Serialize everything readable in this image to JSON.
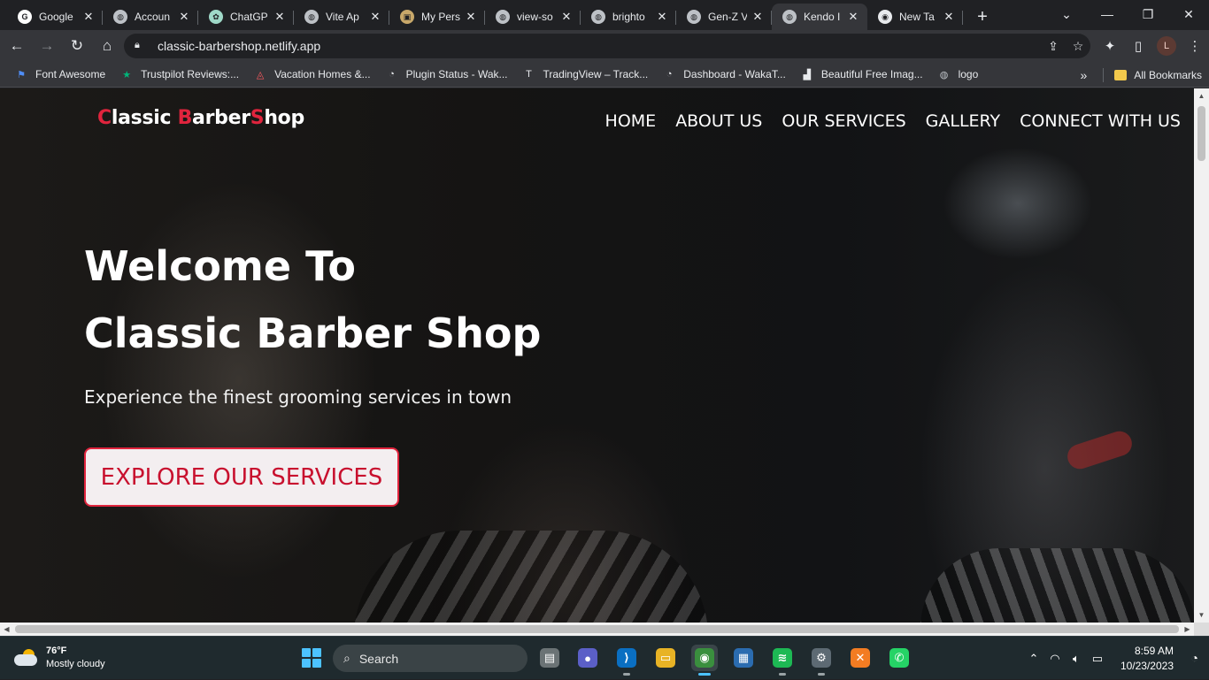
{
  "browser": {
    "tabs": [
      {
        "title": "Google",
        "favicon": "google-icon",
        "color": "#ffffff",
        "glyph": "G"
      },
      {
        "title": "Accoun",
        "favicon": "globe-icon",
        "color": "#bdc1c6",
        "glyph": "◍"
      },
      {
        "title": "ChatGP",
        "favicon": "chatgpt-icon",
        "color": "#9fd9c8",
        "glyph": "✿"
      },
      {
        "title": "Vite Ap",
        "favicon": "globe-icon",
        "color": "#bdc1c6",
        "glyph": "◍"
      },
      {
        "title": "My Pers",
        "favicon": "portfolio-icon",
        "color": "#c8a86a",
        "glyph": "▣"
      },
      {
        "title": "view-so",
        "favicon": "globe-icon",
        "color": "#bdc1c6",
        "glyph": "◍"
      },
      {
        "title": "brighto",
        "favicon": "globe-icon",
        "color": "#bdc1c6",
        "glyph": "◍"
      },
      {
        "title": "Gen-Z V",
        "favicon": "globe-icon",
        "color": "#bdc1c6",
        "glyph": "◍"
      },
      {
        "title": "Kendo I",
        "favicon": "globe-icon",
        "color": "#bdc1c6",
        "glyph": "◍"
      },
      {
        "title": "New Ta",
        "favicon": "chrome-icon",
        "color": "#e8eaed",
        "glyph": "◉"
      }
    ],
    "active_tab_index": 8,
    "url": "classic-barbershop.netlify.app",
    "avatar_letter": "L",
    "bookmarks": [
      {
        "label": "Font Awesome",
        "icon": "flag-icon",
        "glyph": "⚑",
        "color": "#4f8df5"
      },
      {
        "label": "Trustpilot Reviews:...",
        "icon": "star-icon",
        "glyph": "★",
        "color": "#00b67a"
      },
      {
        "label": "Vacation Homes &...",
        "icon": "airbnb-icon",
        "glyph": "◬",
        "color": "#ff5a5f"
      },
      {
        "label": "Plugin Status - Wak...",
        "icon": "wakatime-icon",
        "glyph": "◔",
        "color": "#e8eaed"
      },
      {
        "label": "TradingView – Track...",
        "icon": "tradingview-icon",
        "glyph": "T",
        "color": "#e8eaed"
      },
      {
        "label": "Dashboard - WakaT...",
        "icon": "wakatime-icon",
        "glyph": "◔",
        "color": "#e8eaed"
      },
      {
        "label": "Beautiful Free Imag...",
        "icon": "unsplash-icon",
        "glyph": "▟",
        "color": "#e8eaed"
      },
      {
        "label": "logo",
        "icon": "globe-icon",
        "glyph": "◍",
        "color": "#bdc1c6"
      }
    ],
    "all_bookmarks_label": "All Bookmarks",
    "more_label": "»"
  },
  "site": {
    "logo_parts": [
      {
        "text": "C",
        "red": true
      },
      {
        "text": "lassic ",
        "red": false
      },
      {
        "text": "B",
        "red": true
      },
      {
        "text": "arber",
        "red": false
      },
      {
        "text": "S",
        "red": true
      },
      {
        "text": "hop",
        "red": false
      }
    ],
    "nav": [
      "HOME",
      "ABOUT US",
      "OUR SERVICES",
      "GALLERY",
      "CONNECT WITH US"
    ],
    "headline_line1": "Welcome To",
    "headline_line2": "Classic Barber Shop",
    "subheadline": "Experience the finest grooming services in town",
    "cta_label": "EXPLORE OUR SERVICES",
    "accent_color": "#e0243d"
  },
  "taskbar": {
    "weather_temp": "76°F",
    "weather_desc": "Mostly cloudy",
    "search_label": "Search",
    "time": "8:59 AM",
    "date": "10/23/2023",
    "apps": [
      {
        "name": "file-explorer-icon",
        "glyph": "▤",
        "bg": "#6b7375"
      },
      {
        "name": "meet-icon",
        "glyph": "●",
        "bg": "#5b5fc7"
      },
      {
        "name": "vscode-icon",
        "glyph": "⟩",
        "bg": "#0a6fc2"
      },
      {
        "name": "folder-icon",
        "glyph": "▭",
        "bg": "#e8b325"
      },
      {
        "name": "chrome-icon",
        "glyph": "◉",
        "bg": "#3a8f3e"
      },
      {
        "name": "store-icon",
        "glyph": "▦",
        "bg": "#2b6cb0"
      },
      {
        "name": "spotify-icon",
        "glyph": "≋",
        "bg": "#1db954"
      },
      {
        "name": "settings-icon",
        "glyph": "⚙",
        "bg": "#5d6a73"
      },
      {
        "name": "xampp-icon",
        "glyph": "✕",
        "bg": "#f37c22"
      },
      {
        "name": "whatsapp-icon",
        "glyph": "✆",
        "bg": "#25d366"
      }
    ]
  }
}
